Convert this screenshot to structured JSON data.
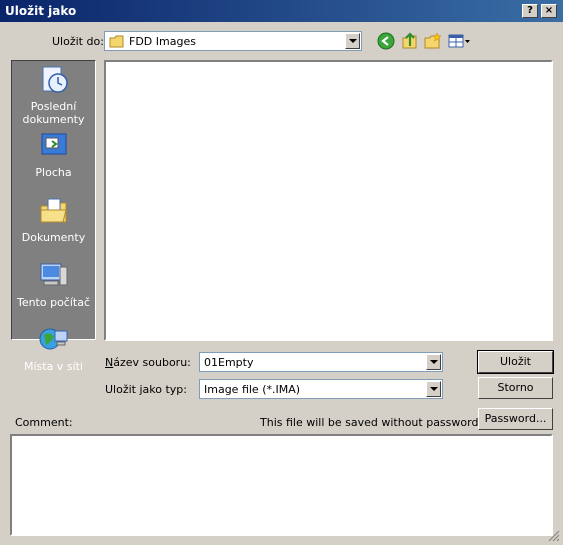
{
  "window": {
    "title": "Uložit jako",
    "help_button": "?",
    "close_button": "×"
  },
  "save_in": {
    "label": "Uložit do:",
    "value": "FDD Images"
  },
  "places": [
    {
      "line1": "Poslední",
      "line2": "dokumenty",
      "icon": "recent-documents-icon"
    },
    {
      "line1": "Plocha",
      "line2": "",
      "icon": "desktop-icon"
    },
    {
      "line1": "Dokumenty",
      "line2": "",
      "icon": "documents-folder-icon"
    },
    {
      "line1": "Tento počítač",
      "line2": "",
      "icon": "my-computer-icon"
    },
    {
      "line1": "Místa v síti",
      "line2": "",
      "icon": "network-places-icon"
    }
  ],
  "file_name": {
    "label": "Název souboru:",
    "value": "01Empty"
  },
  "file_type": {
    "label": "Uložit jako typ:",
    "value": "Image file (*.IMA)"
  },
  "buttons": {
    "save": "Uložit",
    "cancel": "Storno",
    "password": "Password..."
  },
  "comment": {
    "label": "Comment:",
    "value": ""
  },
  "password_status": "This file will be saved without password"
}
